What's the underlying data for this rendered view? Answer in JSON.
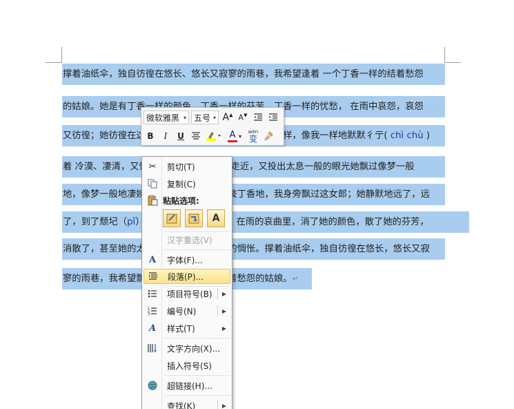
{
  "document": {
    "lines": [
      {
        "text": "撑着油纸伞，独自彷徨在悠长、悠长又寂寥的雨巷，我希望逢着 一个丁香一样的结着愁怨"
      },
      {
        "text": "的姑娘。她是有丁香一样的颜色，丁香一样的芬芳，丁香一样的忧愁， 在雨中哀怨，哀怨"
      },
      {
        "text": "又彷徨；她彷徨在这寂寥的雨巷，撑着油纸伞，像我一样，像我一样地默默彳亍(",
        "pinyin": "chì chù",
        "after": ")"
      },
      {
        "text": "着 冷漠、凄清，又惆怅。她静默地走近、走近，又投出太息一般的眼光她飘过像梦一般"
      },
      {
        "text": "地，像梦一般地凄婉迷茫。像梦中飘过一枝丁香地，我身旁飘过这女郎；她静默地远了，远"
      },
      {
        "text": "了，到了颓圮（",
        "pinyin": "pǐ",
        "after": "）的篱墙，走尽这雨巷。在雨的哀曲里，消了她的颜色，散了她的芬芳，"
      },
      {
        "text": "消散了，甚至她的太息般的眼光，丁香般的惆怅。撑着油纸伞，独自彷徨在悠长，悠长又寂"
      },
      {
        "text": "寥的雨巷，我希望飘过一个丁香一样的结着愁怨的姑娘。",
        "after": "↵"
      }
    ]
  },
  "mini_toolbar": {
    "font_name": "微软雅黑",
    "font_size": "五号",
    "grow_font": "A",
    "shrink_font": "A",
    "bold": "B",
    "italic": "I",
    "underline": "U",
    "font_color_letter": "A",
    "phonetic_guide": "wén",
    "phonetic_char": "变"
  },
  "context_menu": {
    "items": [
      {
        "label": "剪切(T)",
        "icon": "scissors-icon"
      },
      {
        "label": "复制(C)",
        "icon": "copy-icon"
      },
      {
        "label": "汉字重选(V)"
      },
      {
        "label": "字体(F)...",
        "icon": "font-icon"
      },
      {
        "label": "段落(P)...",
        "icon": "paragraph-icon"
      },
      {
        "label": "项目符号(B)",
        "icon": "bullets-icon"
      },
      {
        "label": "编号(N)",
        "icon": "numbering-icon"
      },
      {
        "label": "样式(T)",
        "icon": "styles-icon"
      },
      {
        "label": "文字方向(X)...",
        "icon": "text-direction-icon"
      },
      {
        "label": "插入符号(S)"
      },
      {
        "label": "超链接(H)...",
        "icon": "hyperlink-icon"
      },
      {
        "label": "查找(K)"
      }
    ],
    "paste_header": "粘贴选项:",
    "paste_text_only": "A"
  },
  "colors": {
    "selection": "#a9cdee",
    "menu_hover": "#fbe28c",
    "font_color_red": "#e02020",
    "highlight_yellow": "#ffff00"
  }
}
